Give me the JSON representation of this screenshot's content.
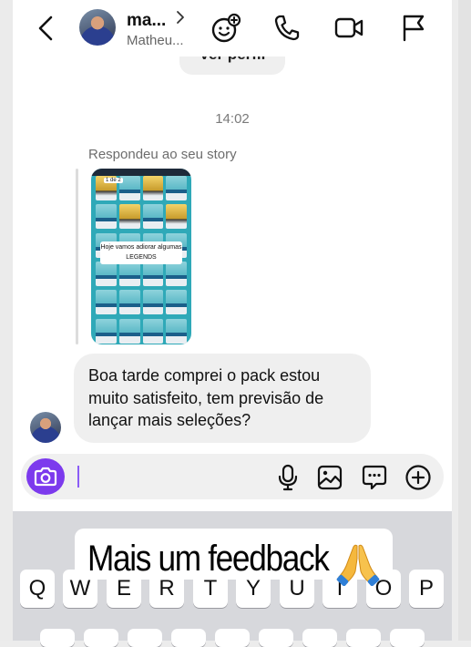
{
  "header": {
    "name": "ma...",
    "username": "Matheu...",
    "back_icon": "chevron-left-icon",
    "actions": [
      "sticker-add-icon",
      "phone-icon",
      "video-icon",
      "flag-icon"
    ]
  },
  "profile_pill": "Ver perfil",
  "thread": {
    "timestamp": "14:02",
    "reply_label": "Respondeu ao seu story",
    "story_caption_line1": "Hoje vamos adiorar algumas",
    "story_caption_line2": "LEGENDS",
    "story_counter": "1 de 2",
    "message": "Boa tarde comprei o pack estou muito satisfeito, tem previsão de lançar mais seleções?"
  },
  "composer": {
    "icons": [
      "camera-icon",
      "microphone-icon",
      "gallery-icon",
      "sticker-chat-icon",
      "plus-circle-icon"
    ],
    "accent": "#7c3aed"
  },
  "keyboard": {
    "keys": [
      "Q",
      "W",
      "E",
      "R",
      "T",
      "Y",
      "U",
      "I",
      "O",
      "P"
    ]
  },
  "overlay": {
    "text": "Mais um feedback",
    "emoji": "🙏"
  }
}
